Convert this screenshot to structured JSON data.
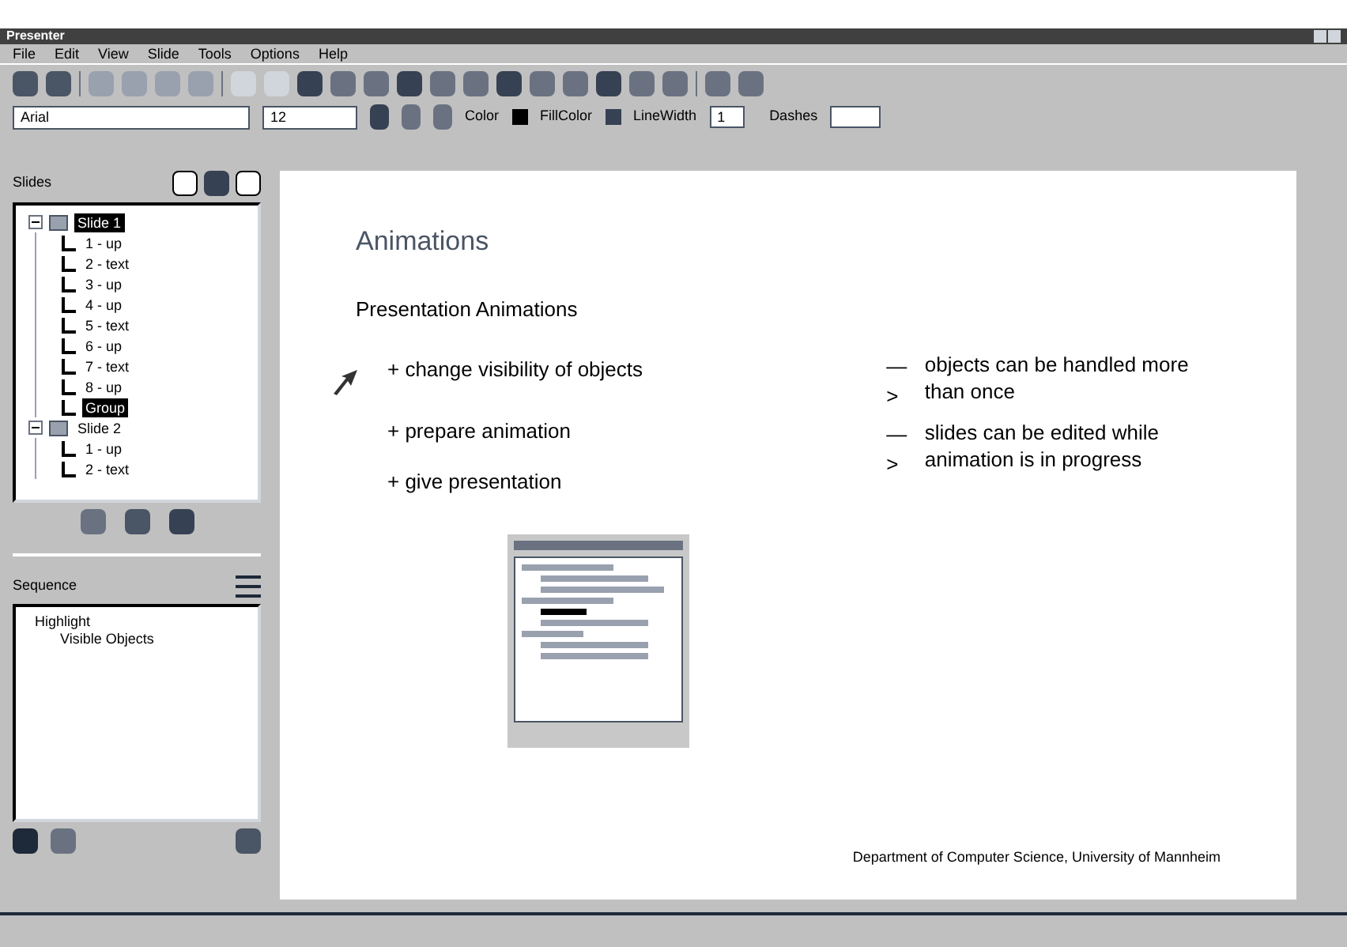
{
  "window": {
    "title": "Presenter"
  },
  "menu": [
    "File",
    "Edit",
    "View",
    "Slide",
    "Tools",
    "Options",
    "Help"
  ],
  "format_bar": {
    "font": "Arial",
    "size": "12",
    "color_label": "Color",
    "fill_label": "FillColor",
    "width_label": "LineWidth",
    "width_value": "1",
    "dash_label": "Dashes"
  },
  "slides_panel": {
    "title": "Slides",
    "tree": [
      {
        "label": "Slide 1",
        "selected": true,
        "expanded": true,
        "children": [
          {
            "label": "1 - up",
            "selected": false
          },
          {
            "label": "2 - text",
            "selected": false
          },
          {
            "label": "3 - up",
            "selected": false
          },
          {
            "label": "4 - up",
            "selected": false
          },
          {
            "label": "5 - text",
            "selected": false
          },
          {
            "label": "6 - up",
            "selected": false
          },
          {
            "label": "7 - text",
            "selected": false
          },
          {
            "label": "8 - up",
            "selected": false
          },
          {
            "label": "Group",
            "selected": true
          }
        ]
      },
      {
        "label": "Slide 2",
        "selected": false,
        "expanded": true,
        "children": [
          {
            "label": "1 - up",
            "selected": false
          },
          {
            "label": "2 - text",
            "selected": false
          }
        ]
      }
    ]
  },
  "sequence_panel": {
    "title": "Sequence",
    "items": [
      "Highlight",
      "Visible Objects"
    ]
  },
  "slide": {
    "title": "Animations",
    "heading": "Presentation Animations",
    "bullets": [
      "+ change visibility of objects",
      "+ prepare animation",
      "+ give presentation"
    ],
    "notes": [
      {
        "arrow": "—>",
        "text": "objects can be handled more than once"
      },
      {
        "arrow": "—>",
        "text": "slides can be edited while animation is in progress"
      }
    ],
    "footer": "Department of Computer Science, University of Mannheim"
  }
}
